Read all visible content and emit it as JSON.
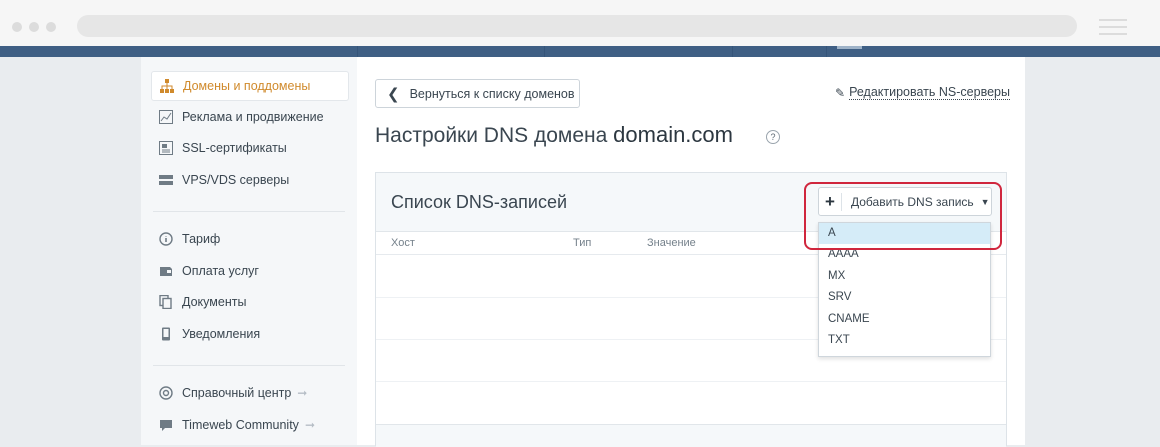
{
  "sidebar": {
    "items": [
      {
        "label": "Домены и поддомены",
        "icon": "sitemap-icon",
        "active": true
      },
      {
        "label": "Реклама и продвижение",
        "icon": "chart-icon"
      },
      {
        "label": "SSL-сертификаты",
        "icon": "certificate-icon"
      },
      {
        "label": "VPS/VDS серверы",
        "icon": "server-icon"
      },
      {
        "label": "Тариф",
        "icon": "info-icon"
      },
      {
        "label": "Оплата услуг",
        "icon": "wallet-icon"
      },
      {
        "label": "Документы",
        "icon": "documents-icon"
      },
      {
        "label": "Уведомления",
        "icon": "phone-icon"
      },
      {
        "label": "Справочный центр",
        "icon": "help-circle-icon"
      },
      {
        "label": "Timeweb Community",
        "icon": "chat-icon"
      }
    ]
  },
  "content": {
    "back_label": "Вернуться к списку доменов",
    "edit_ns_label": "Редактировать NS-серверы",
    "title_prefix": "Настройки DNS домена",
    "domain": "domain.com",
    "help": "?"
  },
  "panel": {
    "title": "Список DNS-записей",
    "add_label": "Добавить DNS запись",
    "columns": [
      "Хост",
      "Тип",
      "Значение"
    ]
  },
  "dropdown": {
    "options": [
      "A",
      "AAAA",
      "MX",
      "SRV",
      "CNAME",
      "TXT"
    ],
    "selected": "A"
  },
  "colors": {
    "accent": "#d08a2c",
    "highlight": "#d0263d",
    "nav": "#3f5f84",
    "selection": "#d5ecf8"
  }
}
